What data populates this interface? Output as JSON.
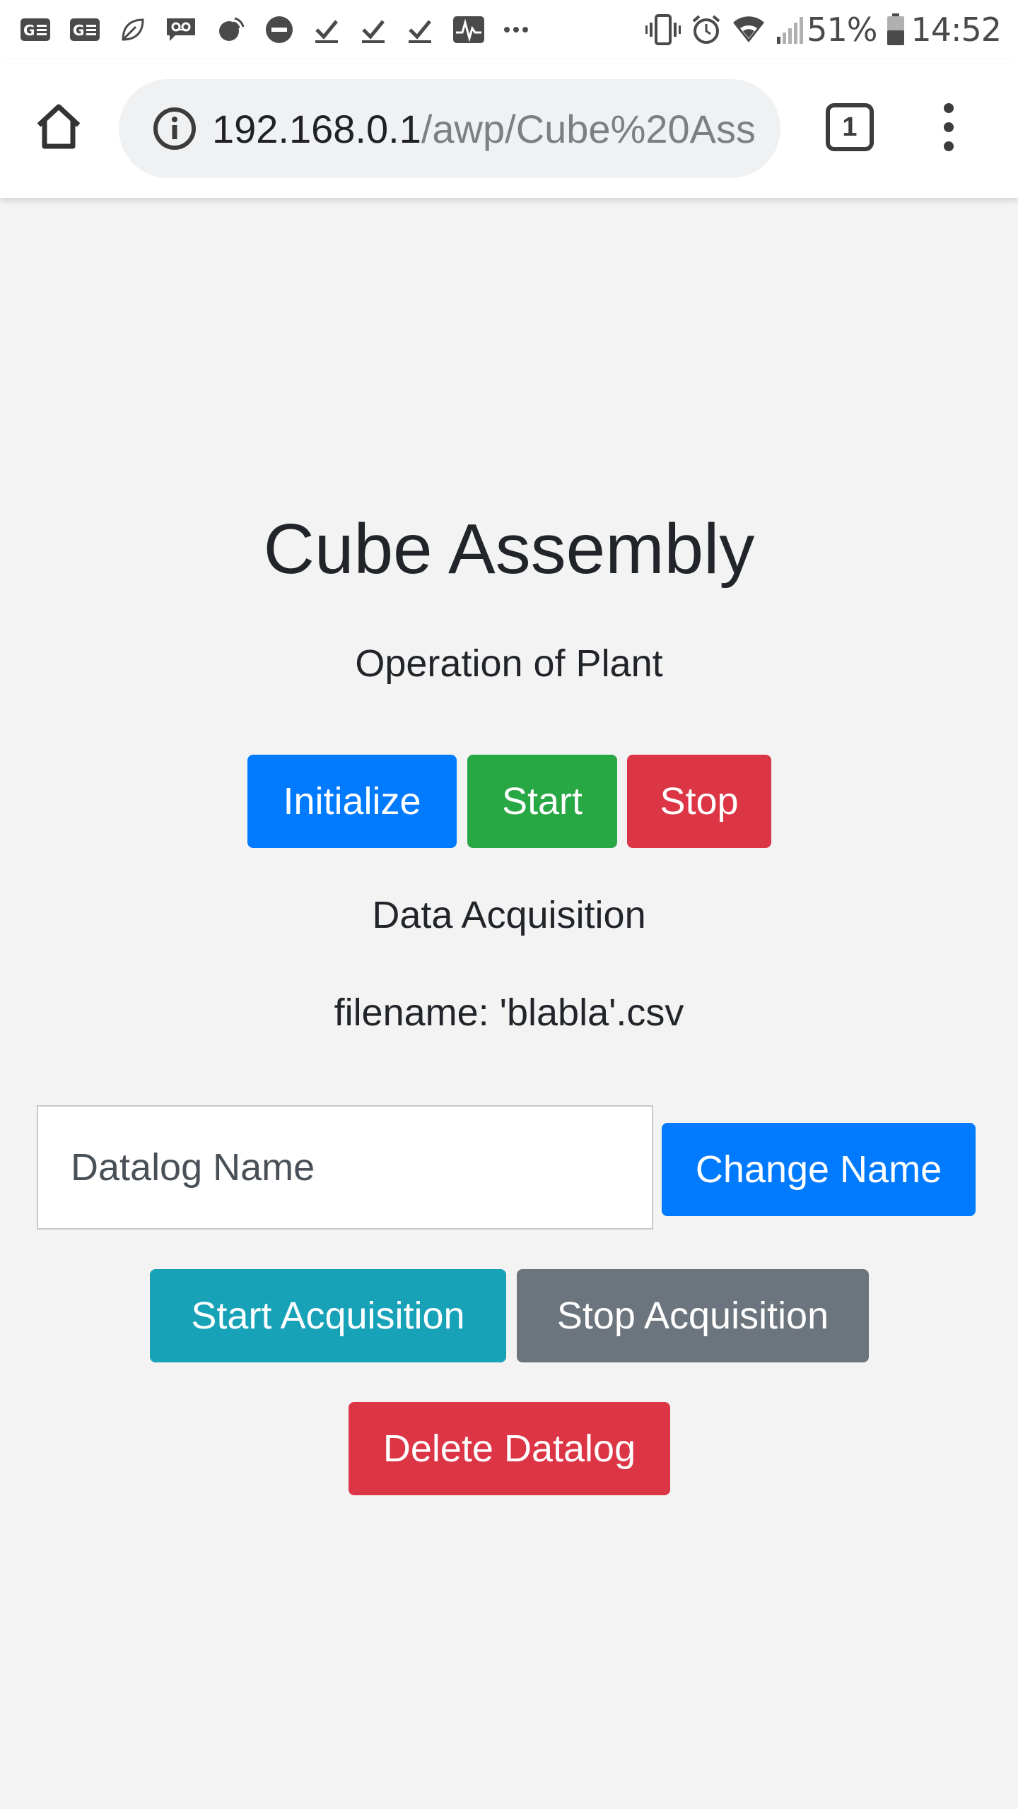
{
  "status_bar": {
    "left_icons": [
      "gmail-icon",
      "gmail-icon",
      "leaf-icon",
      "voicemail-icon",
      "cast-icon",
      "do-not-disturb-icon",
      "download-done-icon",
      "download-done-icon",
      "download-done-icon",
      "activity-icon",
      "more-icon"
    ],
    "battery": "51%",
    "time": "14:52"
  },
  "browser": {
    "url_host": "192.168.0.1",
    "url_path": "/awp/Cube%20Ass",
    "tab_count": "1"
  },
  "page": {
    "title": "Cube Assembly",
    "operation_label": "Operation of Plant",
    "buttons": {
      "initialize": "Initialize",
      "start": "Start",
      "stop": "Stop"
    },
    "data_acquisition_label": "Data Acquisition",
    "filename_text": "filename: 'blabla'.csv",
    "datalog_input": {
      "placeholder": "Datalog Name",
      "value": ""
    },
    "change_name": "Change Name",
    "start_acquisition": "Start Acquisition",
    "stop_acquisition": "Stop Acquisition",
    "delete_datalog": "Delete Datalog"
  },
  "colors": {
    "primary": "#007bff",
    "success": "#28a745",
    "danger": "#dc3545",
    "info": "#17a2b8",
    "secondary": "#6c757d",
    "page_background": "#f3f3f3"
  }
}
